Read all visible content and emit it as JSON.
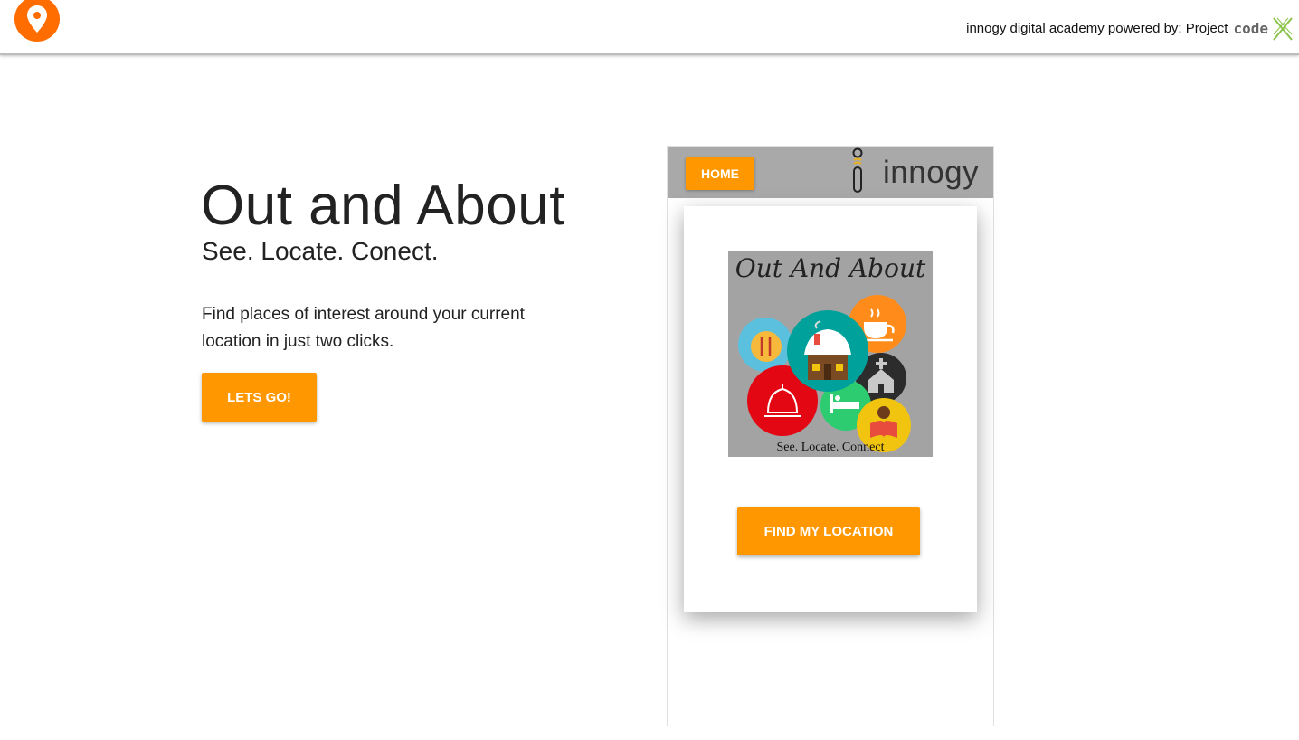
{
  "header": {
    "credit_text": "innogy digital academy powered by: Project",
    "credit_code": "code"
  },
  "hero": {
    "title": "Out and About",
    "subtitle": "See. Locate. Conect.",
    "description": "Find places of interest around your current location in just two clicks.",
    "cta_label": "LETS GO!"
  },
  "phone": {
    "home_label": "HOME",
    "brand": "innogy",
    "poster_title": "Out And About",
    "poster_tagline": "See. Locate. Connect",
    "find_label": "FIND MY LOCATION"
  },
  "colors": {
    "accent": "#ff9800",
    "logo": "#ff6d00",
    "phone_bar": "#a9a9a9",
    "code_green": "#8bc34a"
  },
  "icons": [
    "location-pin-icon",
    "code-x-icon",
    "innogy-i-icon",
    "fork-knife-icon",
    "house-icon",
    "coffee-cup-icon",
    "church-icon",
    "mosque-icon",
    "bed-icon",
    "reader-icon"
  ]
}
